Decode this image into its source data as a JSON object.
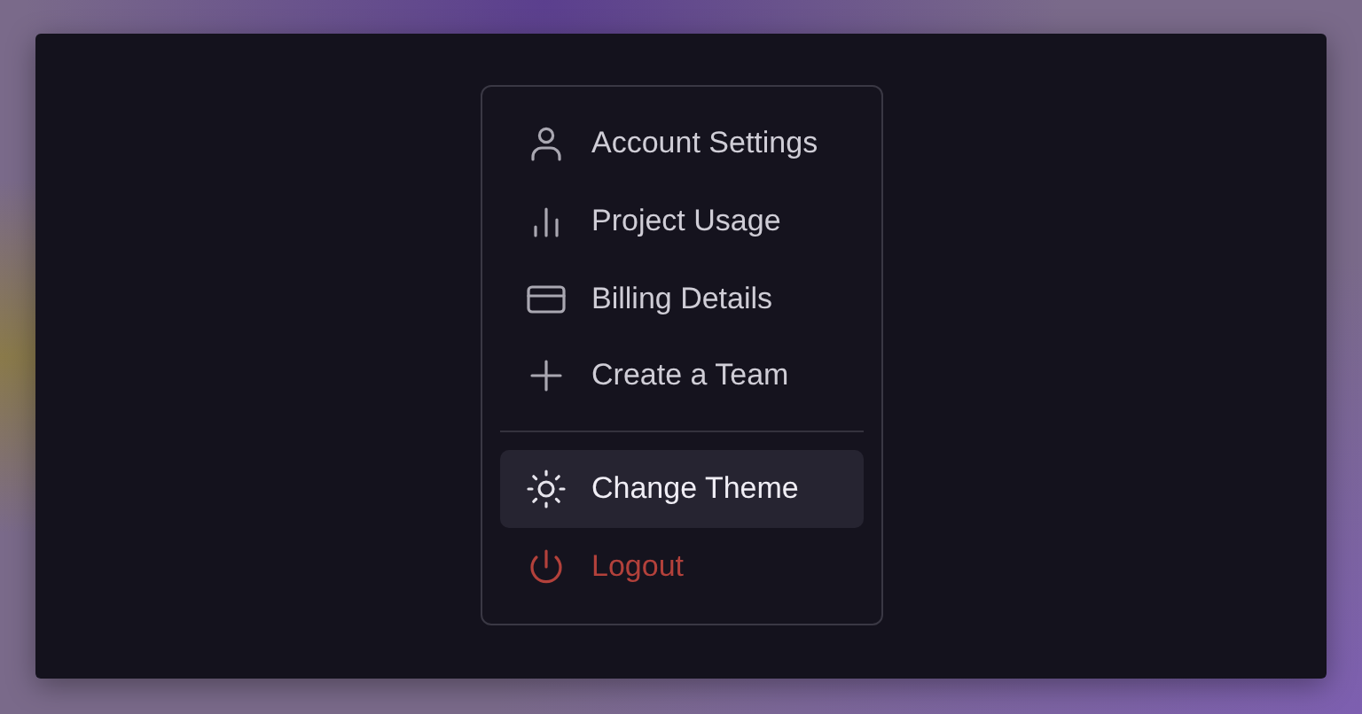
{
  "menu": {
    "groups": [
      {
        "items": [
          {
            "label": "Account Settings",
            "kind": "normal",
            "highlighted": false
          },
          {
            "label": "Project Usage",
            "kind": "normal",
            "highlighted": false
          },
          {
            "label": "Billing Details",
            "kind": "normal",
            "highlighted": false
          },
          {
            "label": "Create a Team",
            "kind": "normal",
            "highlighted": false
          }
        ]
      },
      {
        "items": [
          {
            "label": "Change Theme",
            "kind": "normal",
            "highlighted": true
          },
          {
            "label": "Logout",
            "kind": "danger",
            "highlighted": false
          }
        ]
      }
    ]
  }
}
